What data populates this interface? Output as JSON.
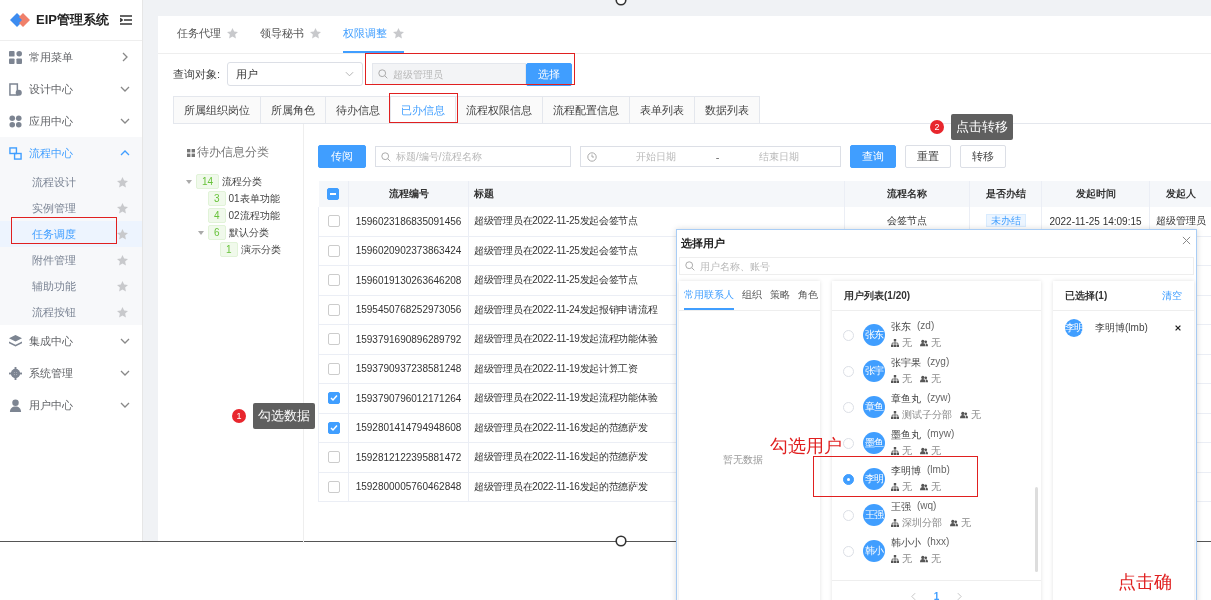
{
  "sidebar": {
    "title": "EIP管理系统",
    "menu": [
      {
        "label": "常用菜单",
        "kind": "link",
        "expanded": false
      },
      {
        "label": "设计中心",
        "kind": "group",
        "expanded": false
      },
      {
        "label": "应用中心",
        "kind": "group",
        "expanded": false
      },
      {
        "label": "流程中心",
        "kind": "group",
        "expanded": true,
        "children": [
          {
            "label": "流程设计",
            "selected": false
          },
          {
            "label": "实例管理",
            "selected": false
          },
          {
            "label": "任务调度",
            "selected": true
          },
          {
            "label": "附件管理",
            "selected": false
          },
          {
            "label": "辅助功能",
            "selected": false
          },
          {
            "label": "流程按钮",
            "selected": false
          }
        ]
      },
      {
        "label": "集成中心",
        "kind": "group",
        "expanded": false
      },
      {
        "label": "系统管理",
        "kind": "group",
        "expanded": false
      },
      {
        "label": "用户中心",
        "kind": "group",
        "expanded": false
      }
    ]
  },
  "page_tabs": [
    {
      "label": "任务代理",
      "selected": false
    },
    {
      "label": "领导秘书",
      "selected": false
    },
    {
      "label": "权限调整",
      "selected": true
    }
  ],
  "query": {
    "label": "查询对象:",
    "target": "用户",
    "search_placeholder": "超级管理员",
    "button": "选择"
  },
  "info_tabs": [
    {
      "label": "所属组织岗位",
      "selected": false
    },
    {
      "label": "所属角色",
      "selected": false
    },
    {
      "label": "待办信息",
      "selected": false
    },
    {
      "label": "已办信息",
      "selected": true
    },
    {
      "label": "流程权限信息",
      "selected": false
    },
    {
      "label": "流程配置信息",
      "selected": false
    },
    {
      "label": "表单列表",
      "selected": false
    },
    {
      "label": "数据列表",
      "selected": false
    }
  ],
  "tree": {
    "title": "待办信息分类",
    "nodes": [
      {
        "label": "流程分类",
        "count": "14",
        "expanded": true,
        "children": [
          {
            "label": "01表单功能",
            "count": "3"
          },
          {
            "label": "02流程功能",
            "count": "4"
          },
          {
            "label": "默认分类",
            "count": "6",
            "expanded": true,
            "children": [
              {
                "label": "演示分类",
                "count": "1"
              }
            ]
          }
        ]
      }
    ]
  },
  "toolbar": {
    "circulate": "传阅",
    "search_placeholder": "标题/编号/流程名称",
    "start_placeholder": "开始日期",
    "separator": "-",
    "end_placeholder": "结束日期",
    "buttons": [
      "查询",
      "重置",
      "转移"
    ]
  },
  "table": {
    "select_all_indeterminate": true,
    "columns": [
      "流程编号",
      "标题",
      "流程名称",
      "是否办结",
      "发起时间",
      "发起人"
    ],
    "rows": [
      {
        "checked": false,
        "id": "1596023186835091456",
        "title": "超级管理员在2022-11-25发起会签节点",
        "flow": "会签节点",
        "status": "未办结",
        "time": "2022-11-25 14:09:15",
        "initiator": "超级管理员"
      },
      {
        "checked": false,
        "id": "1596020902373863424",
        "title": "超级管理员在2022-11-25发起会签节点"
      },
      {
        "checked": false,
        "id": "1596019130263646208",
        "title": "超级管理员在2022-11-25发起会签节点"
      },
      {
        "checked": false,
        "id": "1595450768252973056",
        "title": "超级管理员在2022-11-24发起报销申请流程"
      },
      {
        "checked": false,
        "id": "1593791690896289792",
        "title": "超级管理员在2022-11-19发起流程功能体验"
      },
      {
        "checked": false,
        "id": "1593790937238581248",
        "title": "超级管理员在2022-11-19发起计算工资"
      },
      {
        "checked": true,
        "id": "1593790796012171264",
        "title": "超级管理员在2022-11-19发起流程功能体验"
      },
      {
        "checked": true,
        "id": "1592801414794948608",
        "title": "超级管理员在2022-11-16发起的范德萨发"
      },
      {
        "checked": false,
        "id": "1592812122395881472",
        "title": "超级管理员在2022-11-16发起的范德萨发"
      },
      {
        "checked": false,
        "id": "1592800005760462848",
        "title": "超级管理员在2022-11-16发起的范德萨发"
      }
    ]
  },
  "callouts": [
    {
      "number": "1",
      "text": "勾选数据"
    },
    {
      "number": "2",
      "text": "点击转移"
    }
  ],
  "dialog": {
    "title": "选择用户",
    "search_placeholder": "用户名称、账号",
    "source_tabs": [
      {
        "label": "常用联系人",
        "selected": true
      },
      {
        "label": "组织",
        "selected": false
      },
      {
        "label": "策略",
        "selected": false
      },
      {
        "label": "角色",
        "selected": false
      }
    ],
    "empty_text": "暂无数据",
    "list_title": "用户列表(1/20)",
    "users": [
      {
        "avatar": "张东",
        "name": "张东",
        "account": "(zd)",
        "org": "无",
        "role": "无",
        "selected": false
      },
      {
        "avatar": "张宇",
        "name": "张宇果",
        "account": "(zyg)",
        "org": "无",
        "role": "无",
        "selected": false
      },
      {
        "avatar": "章鱼",
        "name": "章鱼丸",
        "account": "(zyw)",
        "org": "测试子分部",
        "role": "无",
        "selected": false
      },
      {
        "avatar": "墨鱼",
        "name": "墨鱼丸",
        "account": "(myw)",
        "org": "无",
        "role": "无",
        "selected": false
      },
      {
        "avatar": "李明",
        "name": "李明博",
        "account": "(lmb)",
        "org": "无",
        "role": "无",
        "selected": true
      },
      {
        "avatar": "王强",
        "name": "王强",
        "account": "(wq)",
        "org": "深圳分部",
        "role": "无",
        "selected": false
      },
      {
        "avatar": "韩小",
        "name": "韩小小",
        "account": "(hxx)",
        "org": "无",
        "role": "无",
        "selected": false
      }
    ],
    "page": "1",
    "chosen_title": "已选择(1)",
    "clear": "清空",
    "chosen": [
      {
        "avatar": "李明",
        "label": "李明博(lmb)"
      }
    ]
  },
  "annotations": [
    "勾选用户",
    "点击确"
  ]
}
